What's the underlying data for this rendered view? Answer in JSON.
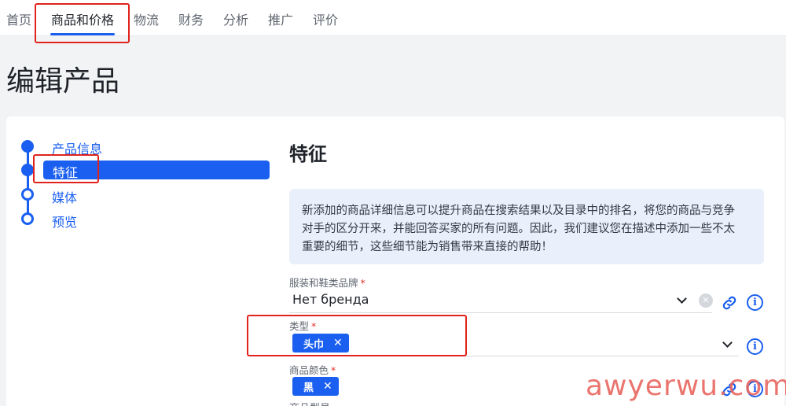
{
  "topnav": {
    "items": [
      "首页",
      "商品和价格",
      "物流",
      "财务",
      "分析",
      "推广",
      "评价"
    ],
    "active_index": 1
  },
  "page": {
    "title": "编辑产品"
  },
  "stepper": {
    "steps": [
      "产品信息",
      "特征",
      "媒体",
      "预览"
    ],
    "active_index": 1
  },
  "section": {
    "title": "特征",
    "info_lines": [
      "新添加的商品详细信息可以提升商品在搜索结果以及目录中的排名，将您的商品与竞争",
      "对手的区分开来，并能回答买家的所有问题。因此，我们建议您在描述中添加一些不太",
      "重要的细节，这些细节能为销售带来直接的帮助！"
    ]
  },
  "fields": {
    "brand": {
      "label": "服装和鞋类品牌",
      "required_mark": "*",
      "value": "Нет бренда"
    },
    "type": {
      "label": "类型",
      "required_mark": "*",
      "chip": "头巾",
      "chip_remove": "✕"
    },
    "color": {
      "label": "商品颜色",
      "required_mark": "*",
      "chip": "黑",
      "chip_remove": "✕"
    }
  },
  "bottom_text": "商品型号……",
  "icons": {
    "info": "i",
    "clear": "✕"
  },
  "watermark": "awyerwu.com",
  "colors": {
    "accent": "#1a5ff0",
    "highlight": "#e0231c",
    "info_bg": "#e9f0fc"
  }
}
